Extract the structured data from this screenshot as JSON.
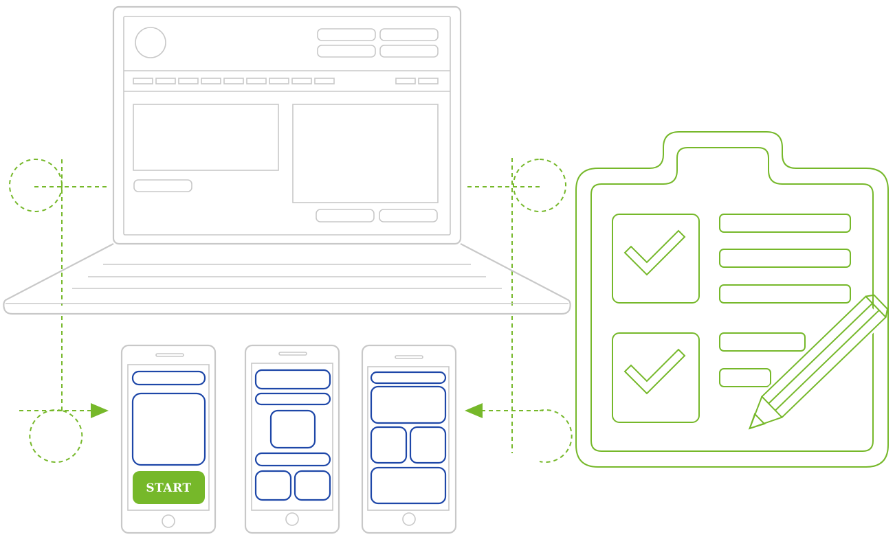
{
  "phone1": {
    "button_label": "START"
  },
  "colors": {
    "accent": "#76b82a",
    "wireframe_blue": "#1e47a8",
    "device_gray": "#c8c8c8"
  },
  "icons": [
    "laptop-icon",
    "phone-icon",
    "clipboard-checklist-icon",
    "pencil-icon",
    "checkmark-icon",
    "arrow-icon"
  ]
}
